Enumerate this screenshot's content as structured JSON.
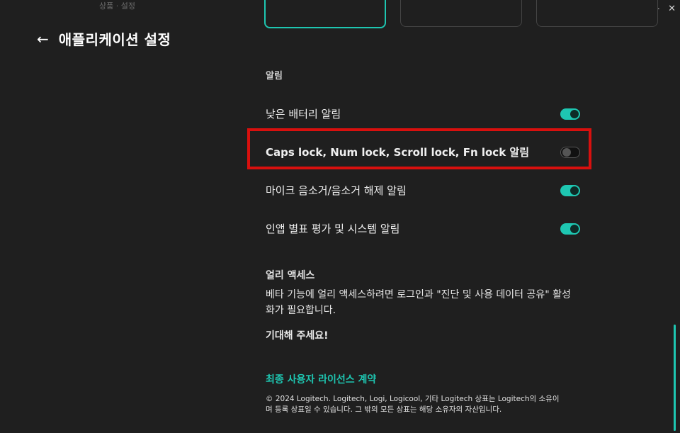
{
  "window": {
    "minimize": "–",
    "close": "✕"
  },
  "top_stub": "상품  ·  설정",
  "header": {
    "back_arrow": "←",
    "title": "애플리케이션 설정"
  },
  "notifications": {
    "section_title": "알림",
    "items": [
      {
        "label": "낮은 배터리 알림",
        "enabled": true
      },
      {
        "label": "Caps lock, Num lock, Scroll lock, Fn lock 알림",
        "enabled": false,
        "highlighted": true
      },
      {
        "label": "마이크 음소거/음소거 해제 알림",
        "enabled": true
      },
      {
        "label": "인앱 별표 평가 및 시스템 알림",
        "enabled": true
      }
    ]
  },
  "early_access": {
    "title": "얼리 액세스",
    "description": "베타 기능에 얼리 액세스하려면 로그인과 \"진단 및 사용 데이터 공유\" 활성화가 필요합니다.",
    "cta": "기대해 주세요!"
  },
  "license": {
    "link": "최종 사용자 라이선스 계약",
    "copyright": "© 2024 Logitech. Logitech, Logi, Logicool, 기타 Logitech 상표는 Logitech의 소유이며 등록 상표일 수 있습니다. 그 밖의 모든 상표는 해당 소유자의 자산입니다."
  },
  "colors": {
    "accent": "#1ec6b1",
    "highlight": "#d8100e",
    "background": "#1f1f1f"
  }
}
